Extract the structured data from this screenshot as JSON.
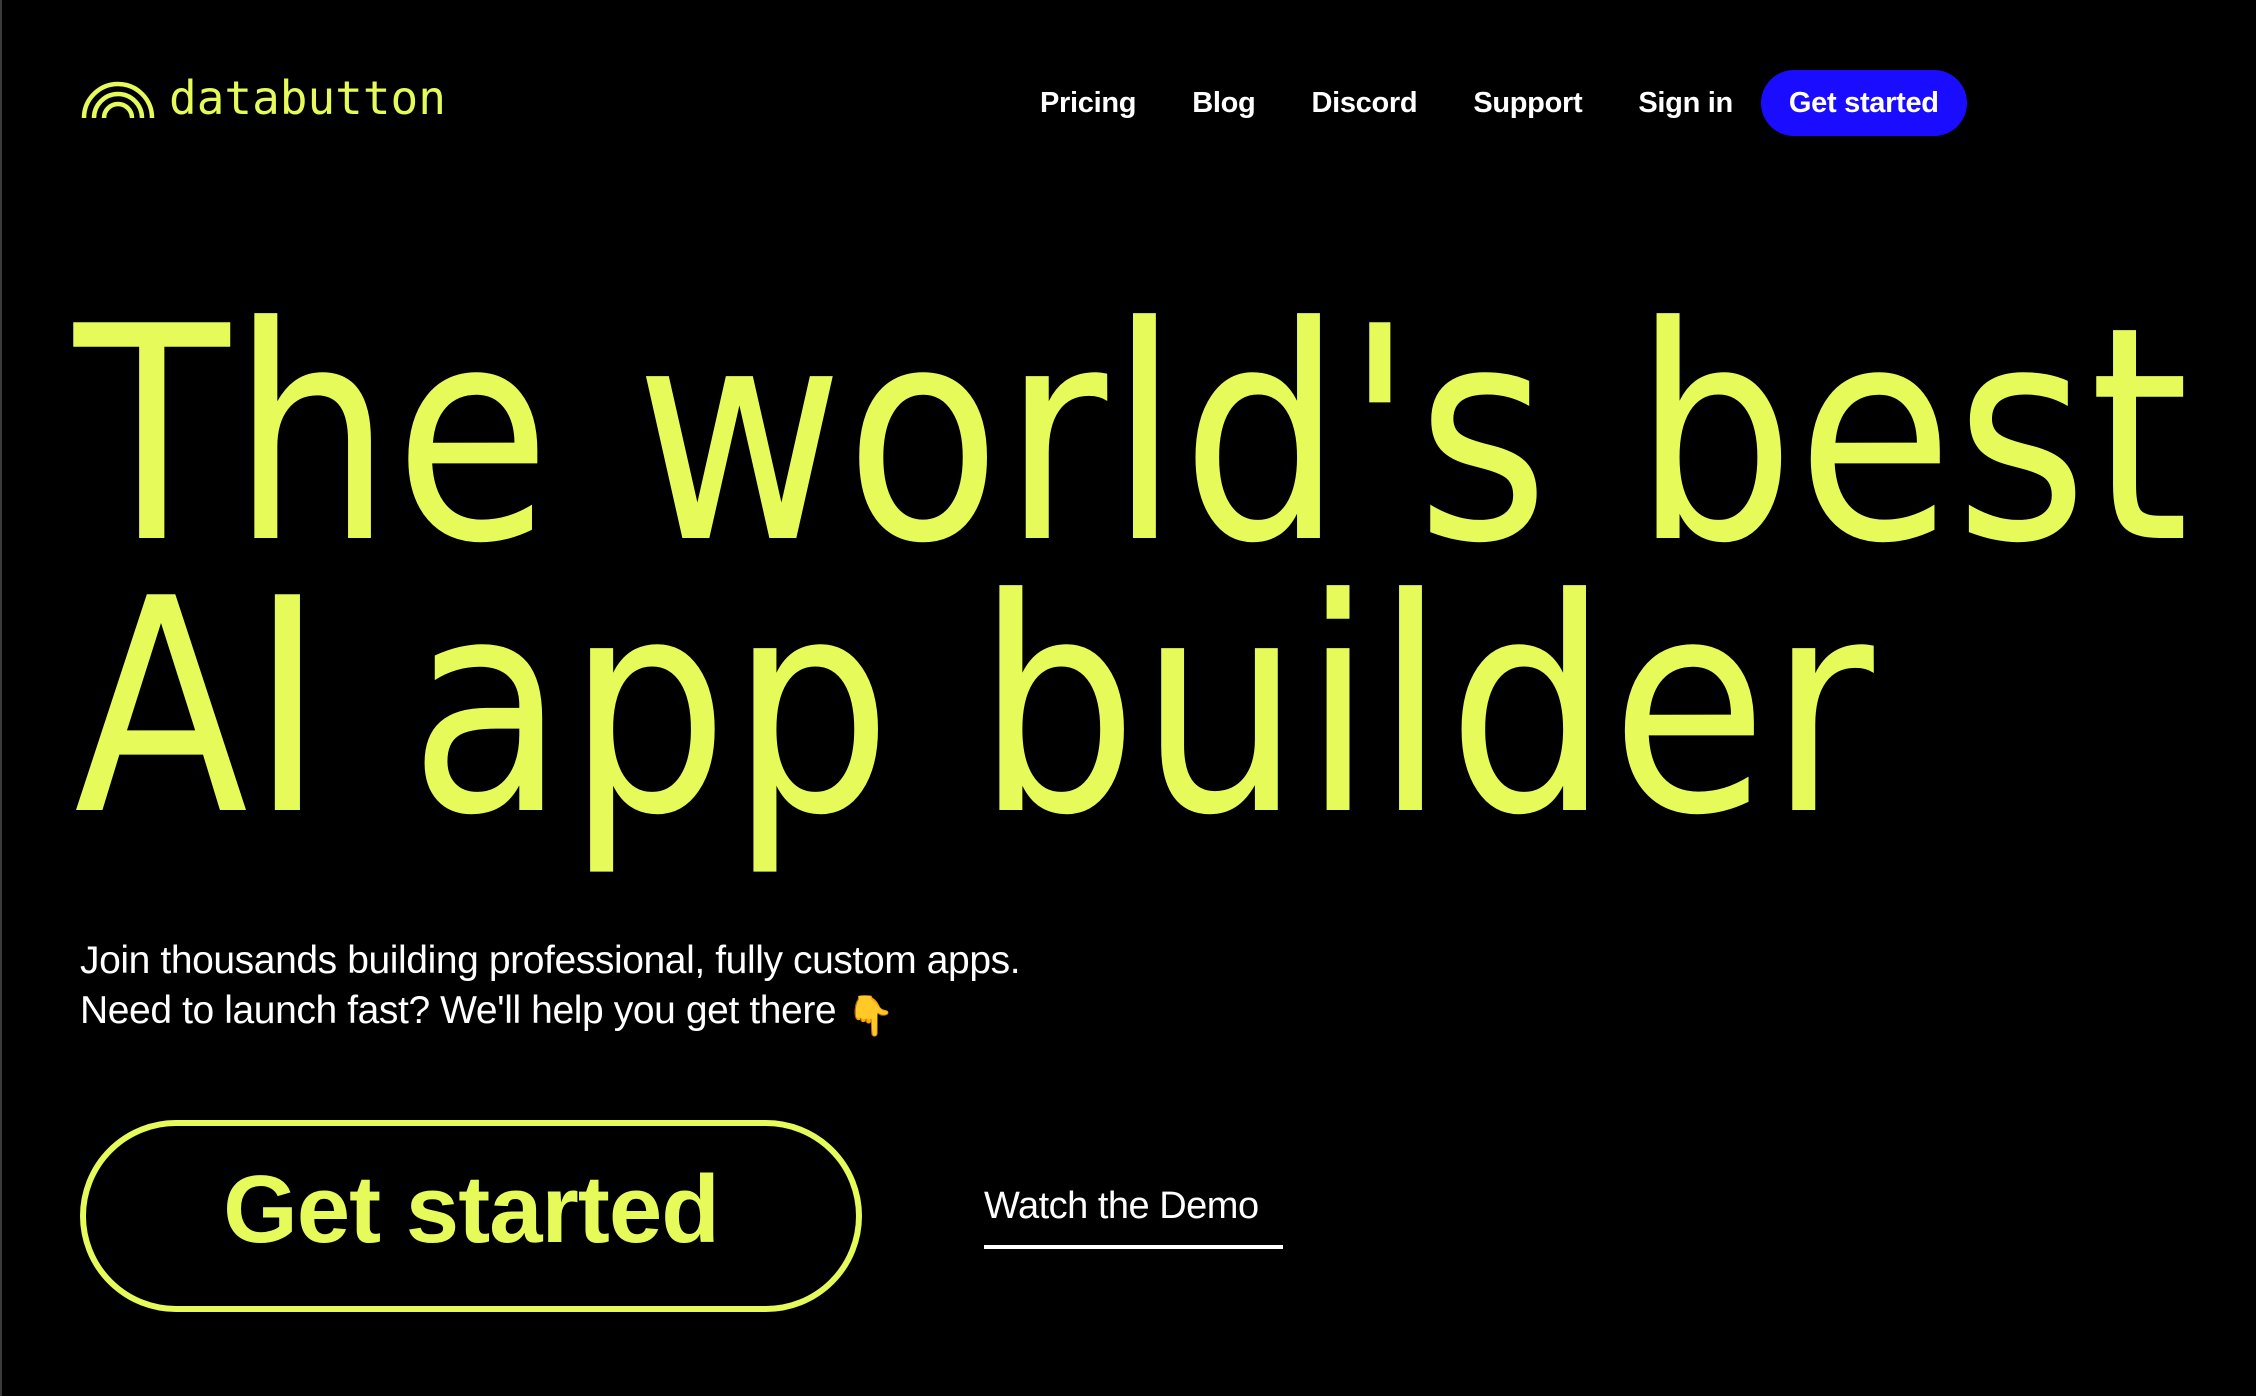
{
  "brand": {
    "name": "databutton",
    "logo_icon": "rainbow-arcs-icon",
    "accent_color": "#e6fa5a",
    "primary_button_color": "#1a0dff",
    "background_color": "#000000"
  },
  "nav": {
    "items": [
      {
        "label": "Pricing"
      },
      {
        "label": "Blog"
      },
      {
        "label": "Discord"
      },
      {
        "label": "Support"
      },
      {
        "label": "Sign in"
      }
    ],
    "cta_label": "Get started"
  },
  "hero": {
    "headline_line1": "The world's best",
    "headline_line2": "AI app builder",
    "subtitle_line1": "Join thousands building professional, fully custom apps.",
    "subtitle_line2": "Need to launch fast? We'll help you get there",
    "subtitle_emoji": "👇",
    "cta_label": "Get started",
    "demo_label": "Watch the Demo"
  }
}
